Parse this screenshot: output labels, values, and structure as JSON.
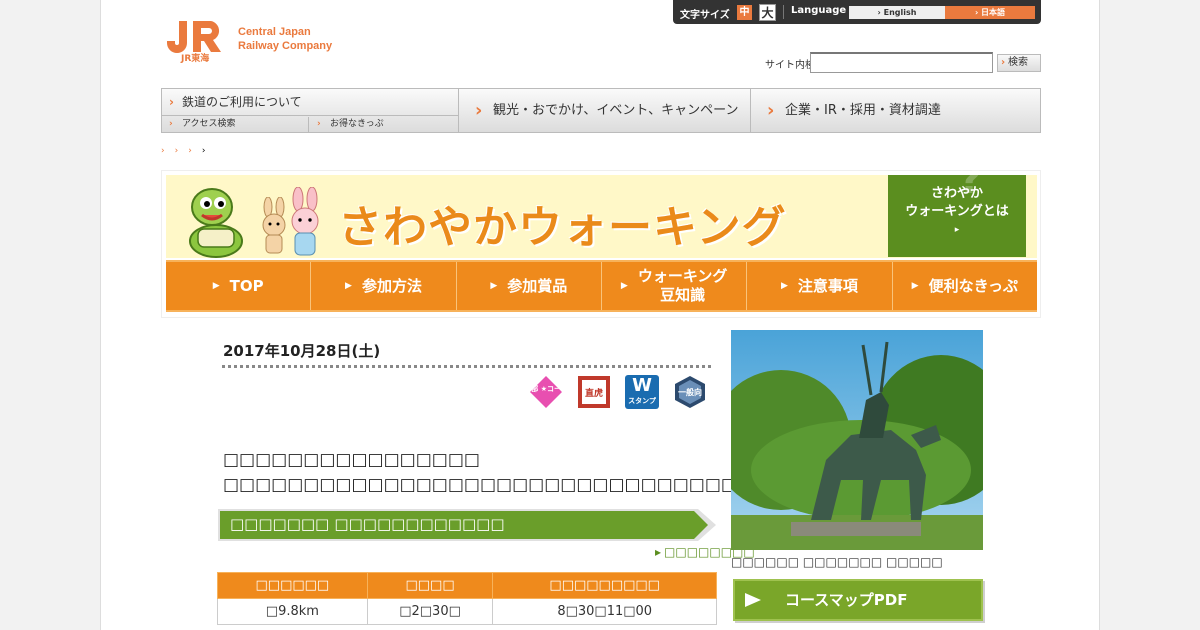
{
  "header": {
    "logo_text_line1": "Central Japan",
    "logo_text_line2": "Railway Company",
    "logo_jr_text": "JR東海",
    "font_size_label": "文字サイズ",
    "font_size_mid": "中",
    "font_size_big": "大",
    "language_label": "Language",
    "lang_english": "› English",
    "lang_japanese": "› 日本語",
    "search_label": "サイト内検索",
    "search_value": "",
    "search_button": "検索"
  },
  "gnav": {
    "item1": "鉄道のご利用について",
    "item1_sub1": "アクセス検索",
    "item1_sub2": "お得なきっぷ",
    "item2": "観光・おでかけ、イベント、キャンペーン",
    "item3": "企業・IR・採用・資材調達"
  },
  "breadcrumb": [
    "›",
    "›",
    "›",
    "›"
  ],
  "banner": {
    "title": "さわやかウォーキング",
    "about_line1": "さわやか",
    "about_line2": "ウォーキングとは",
    "about_arrow": "▸",
    "about_q": "?"
  },
  "subnav": [
    {
      "label": "TOP",
      "line2": ""
    },
    {
      "label": "参加方法",
      "line2": ""
    },
    {
      "label": "参加賞品",
      "line2": ""
    },
    {
      "label": "ウォーキング",
      "line2": "豆知識"
    },
    {
      "label": "注意事項",
      "line2": ""
    },
    {
      "label": "便利なきっぷ",
      "line2": ""
    }
  ],
  "event": {
    "date": "2017年10月28日(土)",
    "icon1": "一部 ★コース",
    "icon2": "直虎",
    "icon3_big": "W",
    "icon3_small": "スタンプ",
    "icon4": "一般向",
    "course_line1": "□□□□□□□□□□□□□□□□",
    "course_line2": "□□□□□□□□□□□□□□□□□□□□□□□□□□□□□□□□□",
    "course_bar": "□□□□□□□ □□□□□□□□□□□□",
    "detail_link": "□□□□□□□□",
    "photo_caption": "□□□□□□ □□□□□□□ □□□□□",
    "pdf_button": "コースマップPDF"
  },
  "info_table": {
    "headers": [
      "□□□□□□",
      "□□□□",
      "□□□□□□□□□"
    ],
    "values": [
      "□9.8km",
      "□2□30□",
      "8□30□11□00"
    ]
  },
  "colors": {
    "brand_orange": "#ea7a3e",
    "nav_orange": "#ef8a1c",
    "green": "#5b8e1f"
  }
}
